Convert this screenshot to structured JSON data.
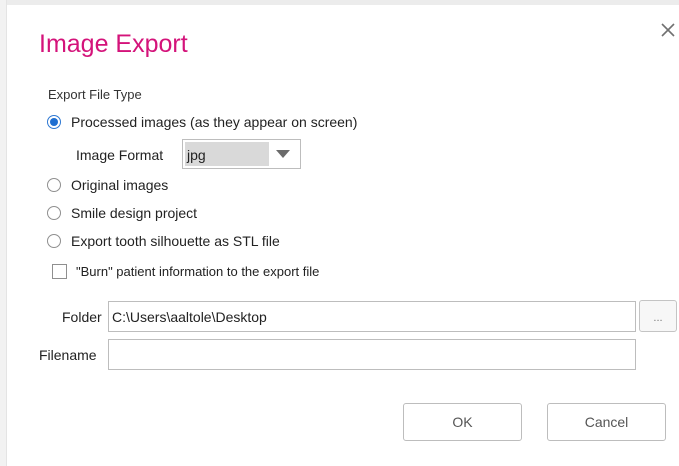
{
  "dialog": {
    "title": "Image Export",
    "close_icon": "close-icon",
    "title_color": "#d4137a",
    "accent_color": "#1f6fd1"
  },
  "export_file_type": {
    "label": "Export File Type",
    "options": [
      {
        "label": "Processed images (as they appear on screen)",
        "selected": true
      },
      {
        "label": "Original images",
        "selected": false
      },
      {
        "label": "Smile design project",
        "selected": false
      },
      {
        "label": "Export tooth silhouette as STL file",
        "selected": false
      }
    ],
    "image_format": {
      "label": "Image Format",
      "value": "jpg"
    }
  },
  "burn_info": {
    "label": "\"Burn\" patient information to the export file",
    "checked": false
  },
  "folder": {
    "label": "Folder",
    "value": "C:\\Users\\aaltole\\Desktop",
    "browse_label": "..."
  },
  "filename": {
    "label": "Filename",
    "value": ""
  },
  "buttons": {
    "ok": "OK",
    "cancel": "Cancel"
  }
}
